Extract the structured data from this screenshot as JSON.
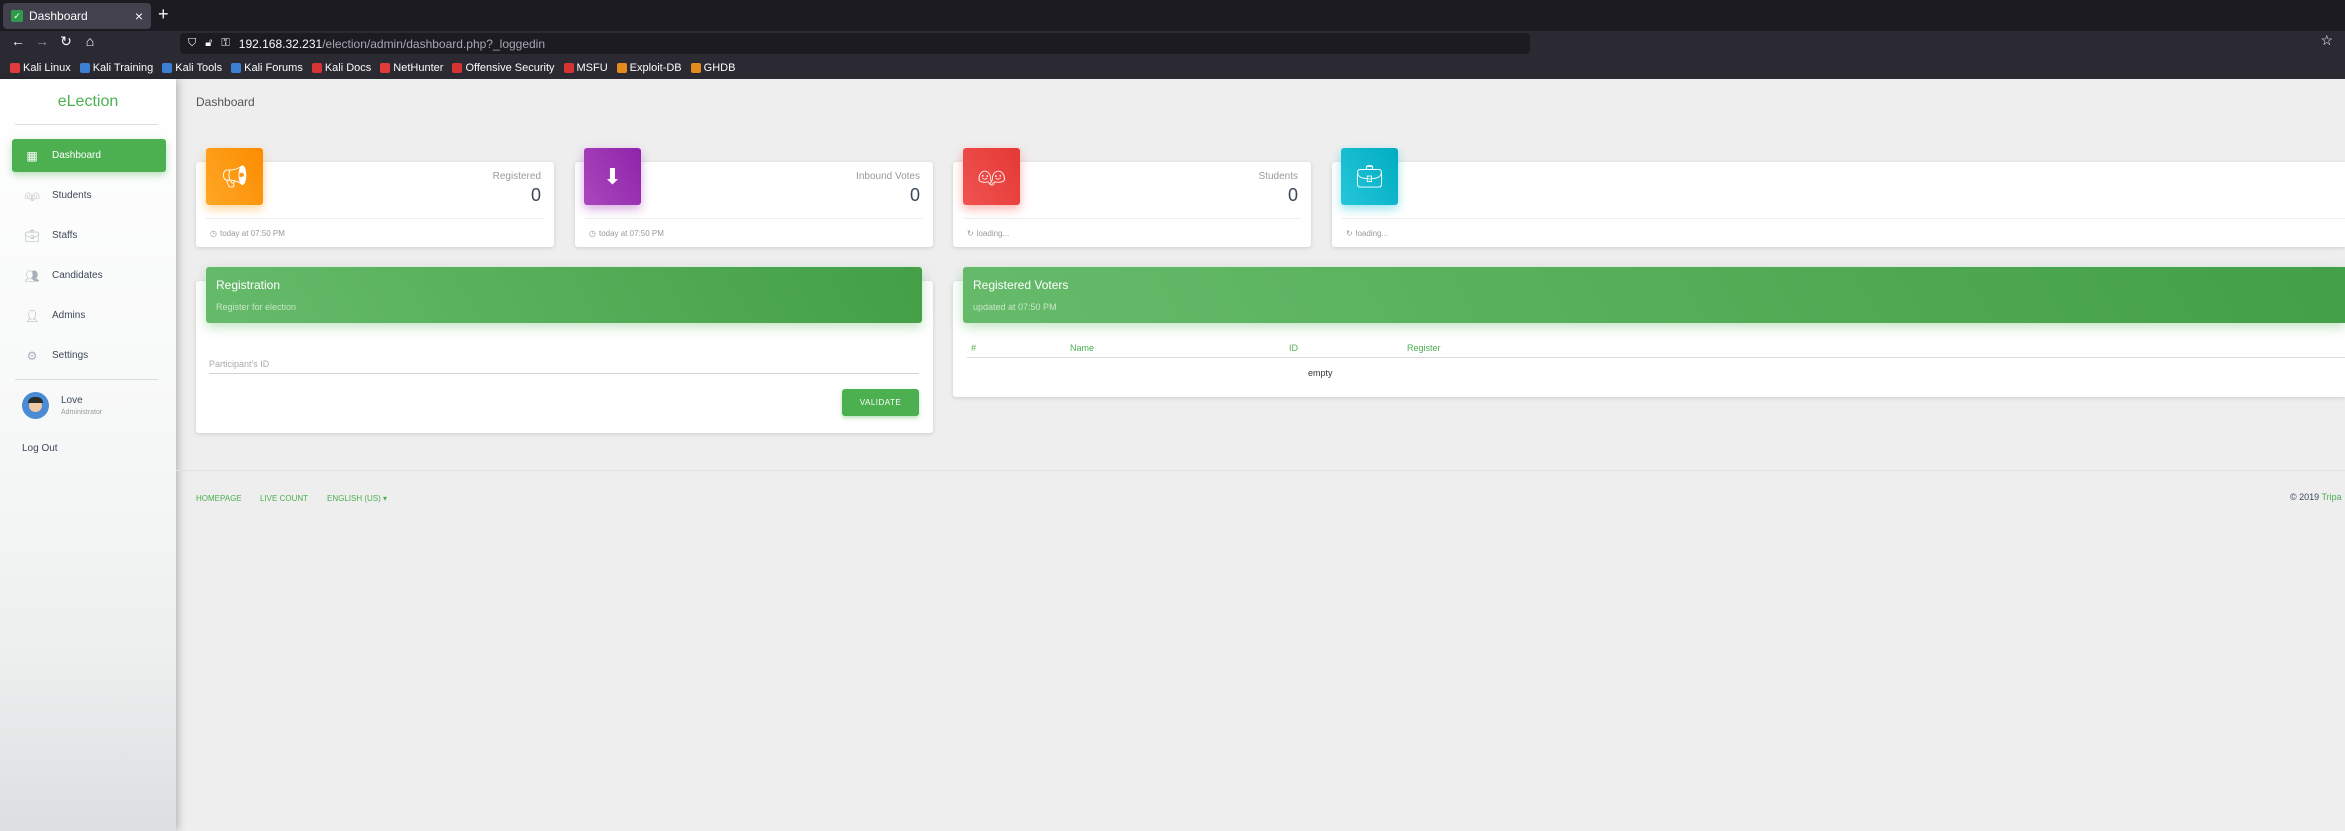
{
  "browser": {
    "tab_title": "Dashboard",
    "tab_close": "×",
    "new_tab": "+",
    "url_host": "192.168.32.231",
    "url_path": "/election/admin/dashboard.php?_loggedin",
    "bookmarks": [
      "Kali Linux",
      "Kali Training",
      "Kali Tools",
      "Kali Forums",
      "Kali Docs",
      "NetHunter",
      "Offensive Security",
      "MSFU",
      "Exploit-DB",
      "GHDB"
    ],
    "bookmark_colors": [
      "#e33b3b",
      "#3e7fd6",
      "#3e7fd6",
      "#3e7fd6",
      "#d63333",
      "#e33b3b",
      "#d63333",
      "#d63333",
      "#e58a1f",
      "#e58a1f"
    ]
  },
  "sidebar": {
    "brand": "eLection",
    "items": [
      {
        "label": "Dashboard",
        "icon": "dashboard-icon"
      },
      {
        "label": "Students",
        "icon": "students-icon"
      },
      {
        "label": "Staffs",
        "icon": "briefcase-icon"
      },
      {
        "label": "Candidates",
        "icon": "people-icon"
      },
      {
        "label": "Admins",
        "icon": "person-icon"
      },
      {
        "label": "Settings",
        "icon": "gear-icon"
      }
    ],
    "user_name": "Love",
    "user_role": "Administrator",
    "logout": "Log Out"
  },
  "main": {
    "title": "Dashboard",
    "stats": [
      {
        "category": "Registered",
        "value": "0",
        "footer": "today at 07:50 PM",
        "color": "#ff9800",
        "icon": "broadcast-icon"
      },
      {
        "category": "Inbound Votes",
        "value": "0",
        "footer": "today at 07:50 PM",
        "color": "#9c27b0",
        "icon": "inbox-icon"
      },
      {
        "category": "Students",
        "value": "0",
        "footer": "loading...",
        "color": "#f44336",
        "icon": "students-icon"
      },
      {
        "category": "",
        "value": "",
        "footer": "loading...",
        "color": "#00bcd4",
        "icon": "briefcase-icon"
      }
    ],
    "registration": {
      "title": "Registration",
      "subtitle": "Register for election",
      "field_label": "Participant's ID",
      "button": "VALIDATE"
    },
    "voters": {
      "title": "Registered Voters",
      "subtitle": "updated at 07:50 PM",
      "columns": [
        "#",
        "Name",
        "ID",
        "Register"
      ],
      "empty": "empty"
    }
  },
  "footer": {
    "links": [
      "HOMEPAGE",
      "LIVE COUNT",
      "ENGLISH (US)"
    ],
    "copyright": "© 2019",
    "copyright_brand": "Tripa"
  }
}
